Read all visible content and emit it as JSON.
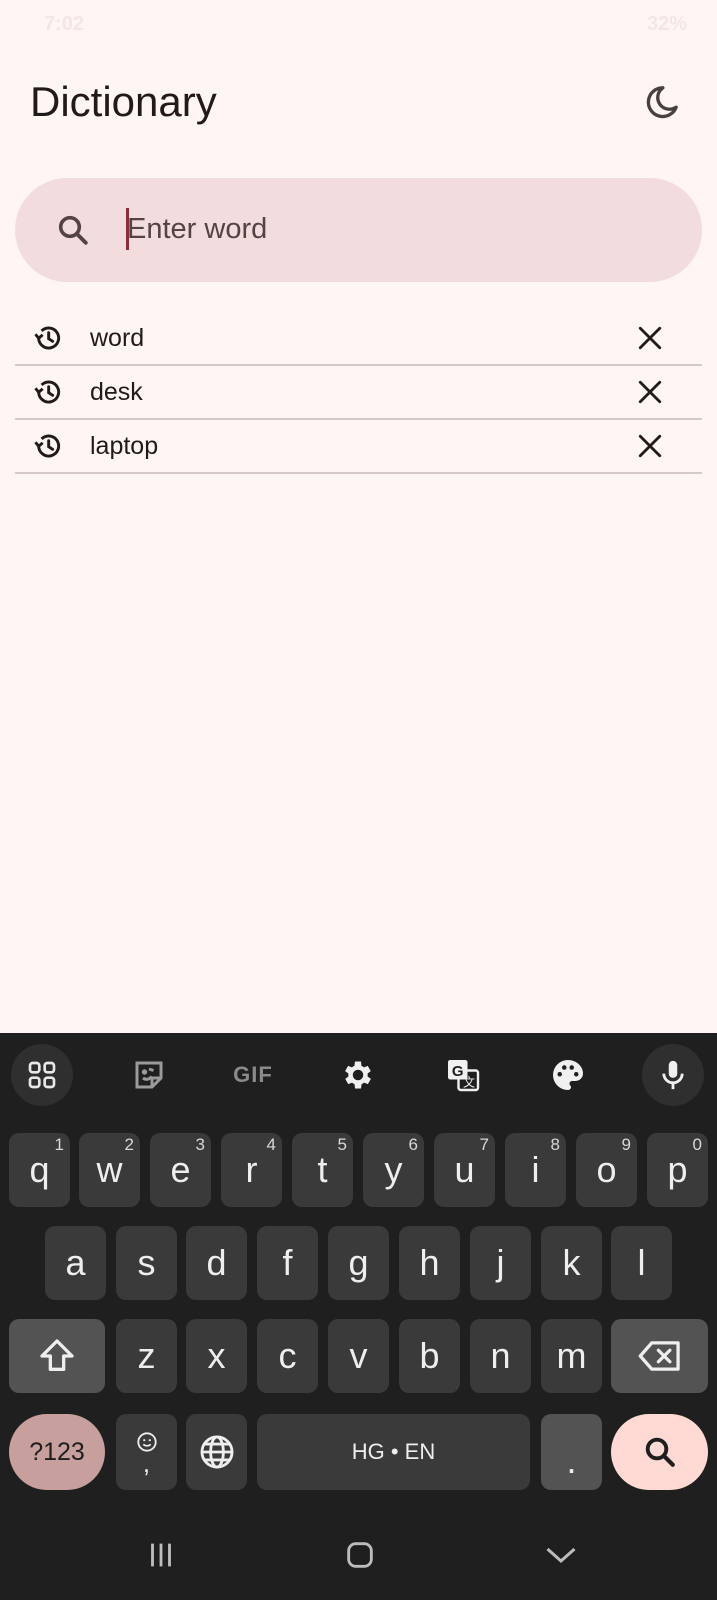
{
  "status_bar": {
    "time": "7:02",
    "battery": "32%"
  },
  "app": {
    "title": "Dictionary"
  },
  "search": {
    "placeholder": "Enter word",
    "value": ""
  },
  "history": [
    {
      "label": "word"
    },
    {
      "label": "desk"
    },
    {
      "label": "laptop"
    }
  ],
  "keyboard": {
    "toolbar": {
      "gif_label": "GIF"
    },
    "rows": [
      [
        {
          "label": "q",
          "hint": "1"
        },
        {
          "label": "w",
          "hint": "2"
        },
        {
          "label": "e",
          "hint": "3"
        },
        {
          "label": "r",
          "hint": "4"
        },
        {
          "label": "t",
          "hint": "5"
        },
        {
          "label": "y",
          "hint": "6"
        },
        {
          "label": "u",
          "hint": "7"
        },
        {
          "label": "i",
          "hint": "8"
        },
        {
          "label": "o",
          "hint": "9"
        },
        {
          "label": "p",
          "hint": "0"
        }
      ],
      [
        {
          "label": "a"
        },
        {
          "label": "s"
        },
        {
          "label": "d"
        },
        {
          "label": "f"
        },
        {
          "label": "g"
        },
        {
          "label": "h"
        },
        {
          "label": "j"
        },
        {
          "label": "k"
        },
        {
          "label": "l"
        }
      ],
      [
        {
          "label": "z"
        },
        {
          "label": "x"
        },
        {
          "label": "c"
        },
        {
          "label": "v"
        },
        {
          "label": "b"
        },
        {
          "label": "n"
        },
        {
          "label": "m"
        }
      ]
    ],
    "symbols_label": "?123",
    "emoji_comma_label": ",",
    "space_label": "HG • EN",
    "period_label": "."
  },
  "colors": {
    "background": "#fff6f4",
    "search_fill": "#f3dcdd",
    "keyboard_bg": "#1f1f1f",
    "key_bg": "#3a3a3a",
    "symbols_key": "#c79f9c",
    "search_key": "#ffdad4"
  }
}
